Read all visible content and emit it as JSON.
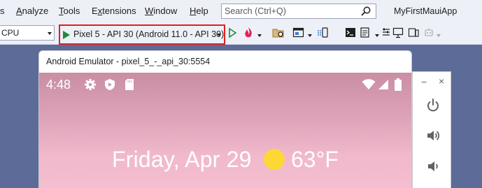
{
  "menu": {
    "items": [
      {
        "pre": "",
        "u": "A",
        "post": "nalyze"
      },
      {
        "pre": "",
        "u": "T",
        "post": "ools"
      },
      {
        "pre": "E",
        "u": "x",
        "post": "tensions"
      },
      {
        "pre": "",
        "u": "W",
        "post": "indow"
      },
      {
        "pre": "",
        "u": "H",
        "post": "elp"
      }
    ],
    "file_tail": "s"
  },
  "search": {
    "placeholder": "Search (Ctrl+Q)"
  },
  "app_title": "MyFirstMauiApp",
  "toolbar": {
    "platform": "CPU",
    "run_target": "Pixel 5 - API 30 (Android 11.0 - API 30)",
    "colors": {
      "play": "#1f8a3c",
      "highlight_border": "#e02020"
    }
  },
  "emulator": {
    "window_title": "Android Emulator - pixel_5_-_api_30:5554",
    "status_time": "4:48",
    "date": "Friday, Apr 29",
    "temperature": "63°F",
    "controls": {
      "minimize": "−",
      "close": "×"
    }
  },
  "icons": [
    "search-icon",
    "gear-icon",
    "shield-play-icon",
    "sd-card-icon",
    "wifi-icon",
    "signal-icon",
    "battery-icon",
    "power-icon",
    "volume-up-icon",
    "volume-down-icon",
    "sun-icon"
  ]
}
